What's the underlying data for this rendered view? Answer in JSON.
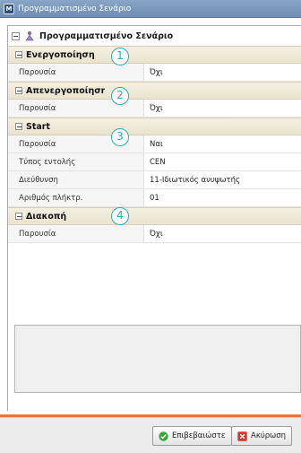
{
  "window": {
    "title": "Προγραμματισμένο Σενάριο",
    "icon": "app-icon"
  },
  "tree": {
    "root_label": "Προγραμματισμένο Σενάριο",
    "groups": [
      {
        "label": "Ενεργοποίηση",
        "badge": "1",
        "rows": [
          {
            "name": "Παρουσία",
            "value": "Όχι"
          }
        ]
      },
      {
        "label": "Απενεργοποίηση",
        "badge": "2",
        "rows": [
          {
            "name": "Παρουσία",
            "value": "Όχι"
          }
        ]
      },
      {
        "label": "Start",
        "badge": "3",
        "rows": [
          {
            "name": "Παρουσία",
            "value": "Ναι"
          },
          {
            "name": "Τύπος εντολής",
            "value": "CEN"
          },
          {
            "name": "Διεύθυνση",
            "value": "11-Ιδιωτικός ανυψωτής"
          },
          {
            "name": "Αριθμός πλήκτρ.",
            "value": "01"
          }
        ]
      },
      {
        "label": "Διακοπή",
        "badge": "4",
        "rows": [
          {
            "name": "Παρουσία",
            "value": "Όχι"
          }
        ]
      }
    ]
  },
  "footer": {
    "confirm_label": "Επιβεβαιώστε",
    "cancel_label": "Ακύρωση",
    "confirm_color": "#3aa53a",
    "cancel_color": "#d23b2b"
  }
}
